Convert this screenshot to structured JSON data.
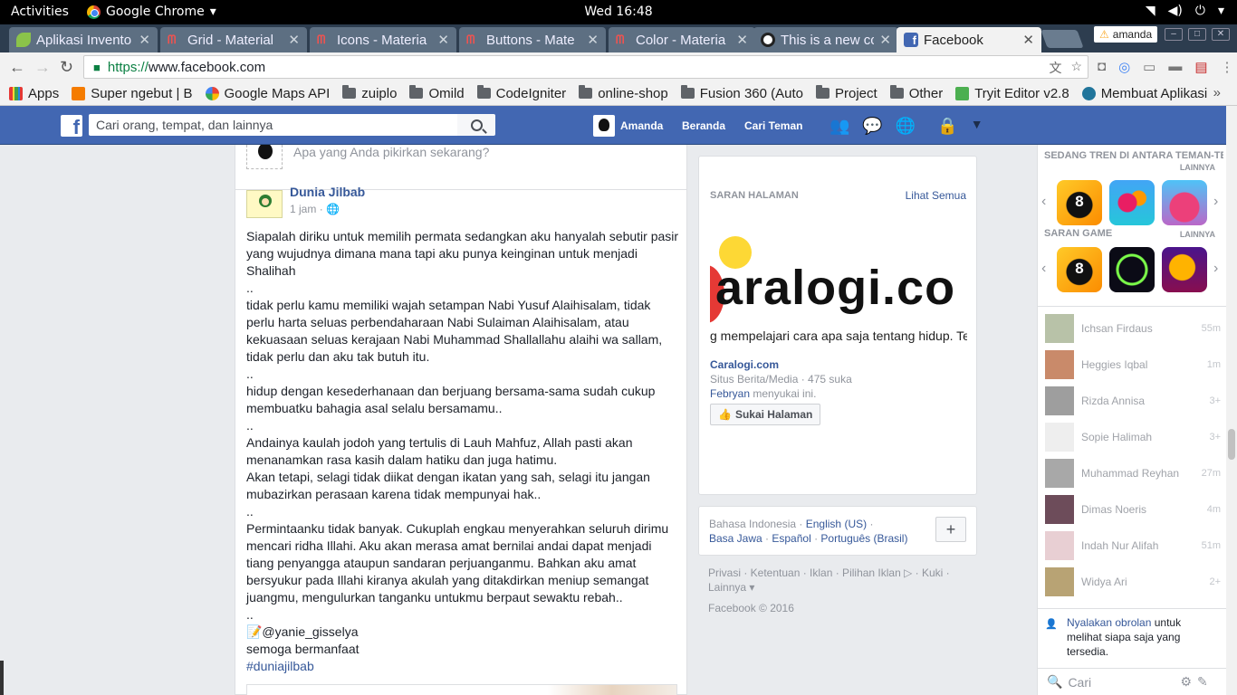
{
  "os_bar": {
    "activities": "Activities",
    "app": "Google Chrome",
    "clock": "Wed 16:48"
  },
  "tabs": [
    {
      "title": "Aplikasi Invento",
      "favicon_color": "#8bc34a"
    },
    {
      "title": "Grid - Material",
      "favicon_color": "#ef5350"
    },
    {
      "title": "Icons - Materia",
      "favicon_color": "#ef5350"
    },
    {
      "title": "Buttons - Mate",
      "favicon_color": "#ef5350"
    },
    {
      "title": "Color - Materia",
      "favicon_color": "#ef5350"
    },
    {
      "title": "This is a new cc",
      "favicon_color": "#222222"
    },
    {
      "title": "Facebook",
      "favicon_color": "#4267b2"
    }
  ],
  "profile_name": "amanda",
  "url": {
    "scheme": "https://",
    "host": "www.facebook.com"
  },
  "bookmarks": [
    "Apps",
    "Super ngebut | B",
    "Google Maps API",
    "zuiplo",
    "Omild",
    "CodeIgniter",
    "online-shop",
    "Fusion 360 (Auto",
    "Project",
    "Other",
    "Tryit Editor v2.8",
    "Membuat Aplikasi"
  ],
  "fb_header": {
    "search_placeholder": "Cari orang, tempat, dan lainnya",
    "profile_name": "Amanda",
    "home": "Beranda",
    "find_friends": "Cari Teman"
  },
  "composer": {
    "placeholder": "Apa yang Anda pikirkan sekarang?"
  },
  "post": {
    "author": "Dunia Jilbab",
    "time": "1 jam",
    "lines": [
      "Siapalah diriku untuk memilih permata sedangkan aku hanyalah sebutir pasir yang wujudnya dimana mana tapi aku punya keinginan untuk menjadi Shalihah",
      "..",
      "tidak perlu kamu memiliki wajah setampan Nabi Yusuf Alaihisalam, tidak perlu harta seluas perbendaharaan Nabi Sulaiman Alaihisalam, atau kekuasaan seluas kerajaan Nabi Muhammad Shallallahu alaihi wa sallam, tidak perlu dan aku tak butuh itu.",
      "..",
      "hidup dengan kesederhanaan dan berjuang bersama-sama sudah cukup membuatku bahagia asal selalu bersamamu..",
      "..",
      "Andainya kaulah jodoh yang tertulis di Lauh Mahfuz, Allah pasti akan menanamkan rasa kasih dalam hatiku dan juga hatimu.",
      "Akan tetapi, selagi tidak diikat dengan ikatan yang sah, selagi itu jangan mubazirkan perasaan karena tidak mempunyai hak..",
      "..",
      "Permintaanku tidak banyak. Cukuplah engkau menyerahkan seluruh dirimu mencari ridha Illahi. Aku akan merasa amat bernilai andai dapat menjadi tiang penyangga ataupun sandaran perjuanganmu. Bahkan aku amat bersyukur pada Illahi kiranya akulah yang ditakdirkan meniup semangat juangmu, mengulurkan tanganku untukmu berpaut sewaktu rebah..",
      "..",
      "📝@yanie_gisselya",
      "semoga bermanfaat"
    ],
    "hashtag": "#duniajilbab"
  },
  "suggested_pages": {
    "title": "SARAN HALAMAN",
    "see_all": "Lihat Semua",
    "banner_brand": "aralogi.co",
    "banner_tagline": "g mempelajari cara apa saja tentang hidup. Te",
    "page_name": "Caralogi.com",
    "category": "Situs Berita/Media · 475 suka",
    "liked_by": "Febryan",
    "liked_suffix": " menyukai ini.",
    "like_button": "Sukai Halaman"
  },
  "languages": {
    "current": "Bahasa Indonesia",
    "options": [
      "English (US)",
      "Basa Jawa",
      "Español",
      "Português (Brasil)"
    ]
  },
  "footer": {
    "links": "Privasi · Ketentuan · Iklan · Pilihan Iklan ▷ · Kuki · Lainnya ▾",
    "copyright": "Facebook © 2016"
  },
  "chat": {
    "trending_title": "SEDANG TREN DI ANTARA TEMAN-TEMAN",
    "more": "LAINNYA",
    "games_title": "SARAN GAME",
    "contacts": [
      {
        "name": "Ichsan Firdaus",
        "time": "55m",
        "color": "#b8c2a8"
      },
      {
        "name": "Heggies Iqbal",
        "time": "1m",
        "color": "#c98a6a"
      },
      {
        "name": "Rizda Annisa",
        "time": "3+",
        "color": "#9e9e9e"
      },
      {
        "name": "Sopie Halimah",
        "time": "3+",
        "color": "#eeeeee"
      },
      {
        "name": "Muhammad Reyhan",
        "time": "27m",
        "color": "#a8a8a8"
      },
      {
        "name": "Dimas Noeris",
        "time": "4m",
        "color": "#6d4c5a"
      },
      {
        "name": "Indah Nur Alifah",
        "time": "51m",
        "color": "#e8cfd3"
      },
      {
        "name": "Widya Ari",
        "time": "2+",
        "color": "#b8a374"
      }
    ],
    "hint_link": "Nyalakan obrolan",
    "hint_text": " untuk melihat siapa saja yang tersedia.",
    "search_placeholder": "Cari"
  }
}
